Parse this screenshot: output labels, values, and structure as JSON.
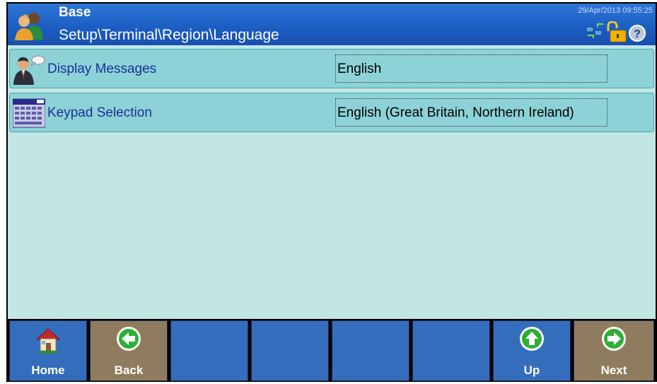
{
  "header": {
    "title": "Base",
    "path": "Setup\\Terminal\\Region\\Language",
    "datetime": "29/Apr/2013 09:55:25"
  },
  "rows": [
    {
      "label": "Display Messages",
      "value": "English",
      "icon": "person-speaking-icon"
    },
    {
      "label": "Keypad Selection",
      "value": "English (Great Britain, Northern Ireland)",
      "icon": "keypad-icon"
    }
  ],
  "softkeys": [
    {
      "label": "Home",
      "icon": "home-icon"
    },
    {
      "label": "Back",
      "icon": "arrow-left-icon"
    },
    {
      "label": "",
      "icon": ""
    },
    {
      "label": "",
      "icon": ""
    },
    {
      "label": "",
      "icon": ""
    },
    {
      "label": "",
      "icon": ""
    },
    {
      "label": "Up",
      "icon": "arrow-up-icon"
    },
    {
      "label": "Next",
      "icon": "arrow-right-icon"
    }
  ],
  "colors": {
    "header_blue": "#1c5fc4",
    "content_bg": "#c1e6e4",
    "row_bg": "#8dd2d6",
    "softkey_blue": "#356dbd",
    "softkey_tan": "#8f7b5d",
    "arrow_green": "#2fae35"
  }
}
